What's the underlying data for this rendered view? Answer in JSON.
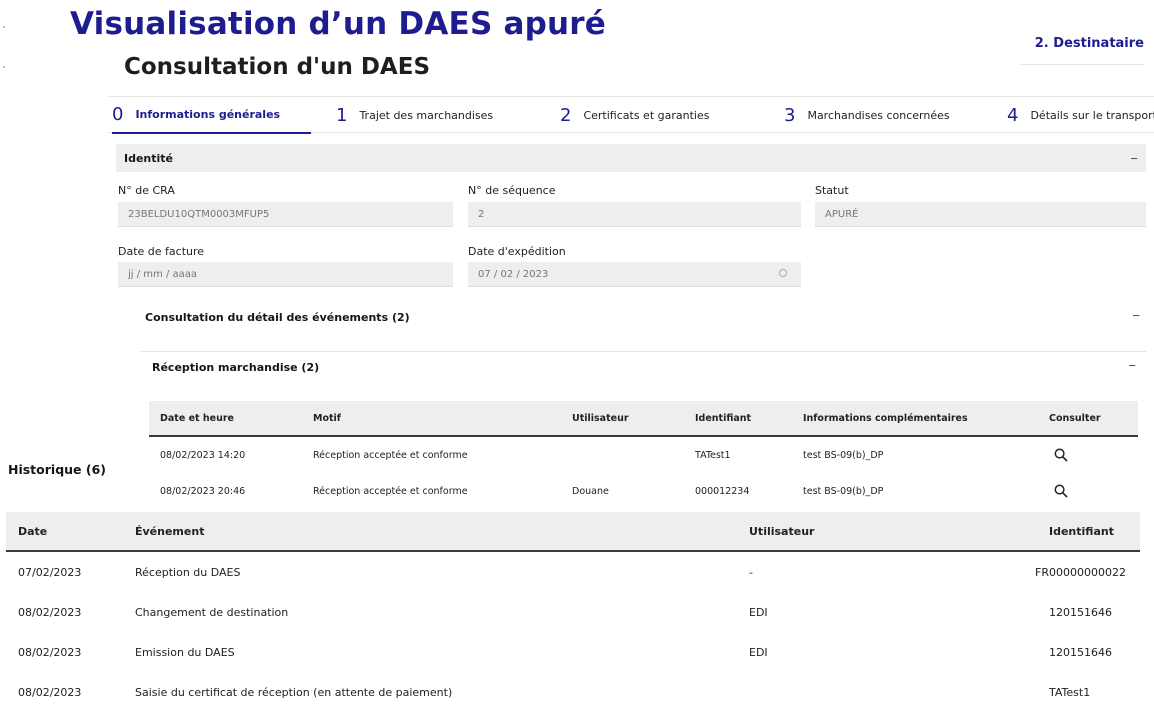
{
  "header": {
    "title": "Visualisation d’un DAES apuré",
    "subtitle": "Consultation d'un DAES",
    "destination_link": "2. Destinataire"
  },
  "stepper": [
    {
      "num": "0",
      "label": "Informations générales",
      "active": true
    },
    {
      "num": "1",
      "label": "Trajet des marchandises",
      "active": false
    },
    {
      "num": "2",
      "label": "Certificats et garanties",
      "active": false
    },
    {
      "num": "3",
      "label": "Marchandises concernées",
      "active": false
    },
    {
      "num": "4",
      "label": "Détails sur le transport",
      "active": false
    }
  ],
  "identity": {
    "section_title": "Identité",
    "toggle": "−",
    "cra_label": "N° de CRA",
    "cra_value": "23BELDU10QTM0003MFUP5",
    "seq_label": "N° de séquence",
    "seq_value": "2",
    "status_label": "Statut",
    "status_value": "APURÉ",
    "invoice_date_label": "Date de facture",
    "invoice_date_placeholder": "jj / mm / aaaa",
    "ship_date_label": "Date d'expédition",
    "ship_date_value": "07 / 02 / 2023"
  },
  "events": {
    "title": "Consultation du détail des événements (2)",
    "toggle": "−",
    "reception": {
      "title": "Réception marchandise (2)",
      "toggle": "−",
      "columns": [
        "Date et heure",
        "Motif",
        "Utilisateur",
        "Identifiant",
        "Informations complémentaires",
        "Consulter"
      ],
      "rows": [
        {
          "datetime": "08/02/2023 14:20",
          "motif": "Réception acceptée et conforme",
          "user": "",
          "id": "TATest1",
          "info": "test BS-09(b)_DP",
          "action_icon": "search-icon"
        },
        {
          "datetime": "08/02/2023 20:46",
          "motif": "Réception acceptée et conforme",
          "user": "Douane",
          "id": "000012234",
          "info": "test BS-09(b)_DP",
          "action_icon": "search-icon"
        }
      ]
    }
  },
  "history": {
    "title": "Historique (6)",
    "columns": [
      "Date",
      "Événement",
      "Utilisateur",
      "Identifiant"
    ],
    "rows": [
      {
        "date": "07/02/2023",
        "event": "Réception du DAES",
        "user": "-",
        "id": "FR00000000022"
      },
      {
        "date": "08/02/2023",
        "event": "Changement de destination",
        "user": "EDI",
        "id": "120151646"
      },
      {
        "date": "08/02/2023",
        "event": "Emission du DAES",
        "user": "EDI",
        "id": "120151646"
      },
      {
        "date": "08/02/2023",
        "event": "Saisie du certificat de réception (en attente de paiement)",
        "user": "",
        "id": "TATest1"
      }
    ]
  },
  "colors": {
    "accent": "#1d1d8f",
    "field_bg": "#eeeeee",
    "rule": "#3a3a3a"
  }
}
